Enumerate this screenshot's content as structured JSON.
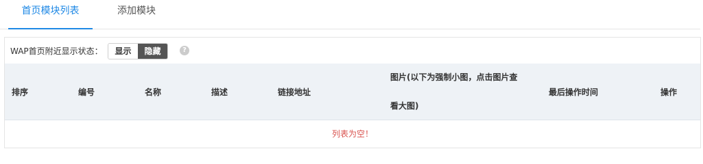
{
  "tabs": [
    {
      "label": "首页模块列表",
      "active": true
    },
    {
      "label": "添加模块",
      "active": false
    }
  ],
  "status": {
    "label": "WAP首页附近显示状态：",
    "options": [
      "显示",
      "隐藏"
    ],
    "selected": "隐藏",
    "help_glyph": "?"
  },
  "table": {
    "headers": [
      "排序",
      "编号",
      "名称",
      "描述",
      "链接地址",
      "图片(以下为强制小图，点击图片查看大图)",
      "最后操作时间",
      "操作"
    ],
    "empty_text": "列表为空！"
  },
  "colors": {
    "accent": "#1e88e5",
    "toggle_selected_bg": "#555555",
    "header_bg": "#eef2f6",
    "empty_text": "#d9534f"
  }
}
